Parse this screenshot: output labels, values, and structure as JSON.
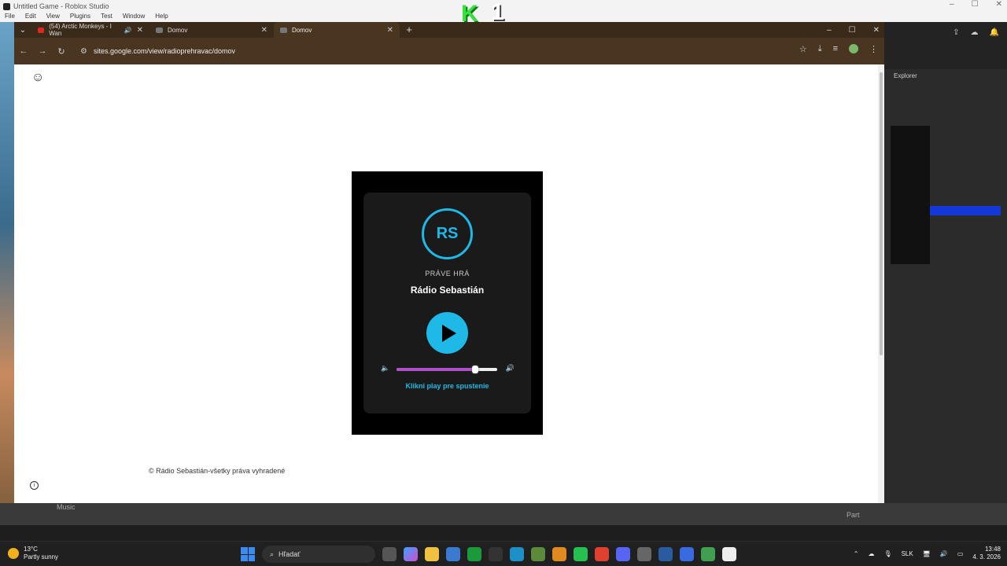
{
  "studio": {
    "title": "Untitled Game - Roblox Studio",
    "menu": [
      "File",
      "Edit",
      "View",
      "Plugins",
      "Test",
      "Window",
      "Help"
    ],
    "explorer_label": "Explorer",
    "bottom_left": "Music",
    "bottom_right": "Part"
  },
  "overlay_logo": {
    "letter": "K",
    "number": "1"
  },
  "browser": {
    "tabs": [
      {
        "label": "(54) Arctic Monkeys - I Wan",
        "favicon_color": "#e0271f",
        "active": false,
        "muted_icon": "speaker-icon"
      },
      {
        "label": "Domov",
        "favicon_color": "#777777",
        "active": false
      },
      {
        "label": "Domov",
        "favicon_color": "#777777",
        "active": true
      }
    ],
    "url": "sites.google.com/view/radioprehravac/domov"
  },
  "player": {
    "badge": "RS",
    "now_playing_label": "PRÁVE HRÁ",
    "station_name": "Rádio Sebastián",
    "volume_level": 0.78,
    "hint": "Klikni play pre spustenie",
    "accent_color": "#1eb9e6",
    "volume_color": "#b14fc8"
  },
  "footer": {
    "copyright": "© Rádio Sebastián-všetky práva vyhradené"
  },
  "taskbar": {
    "temperature": "13°C",
    "weather": "Partly sunny",
    "search_placeholder": "Hľadať",
    "language": "SLK",
    "time": "13:48",
    "date": "4. 3. 2026"
  }
}
